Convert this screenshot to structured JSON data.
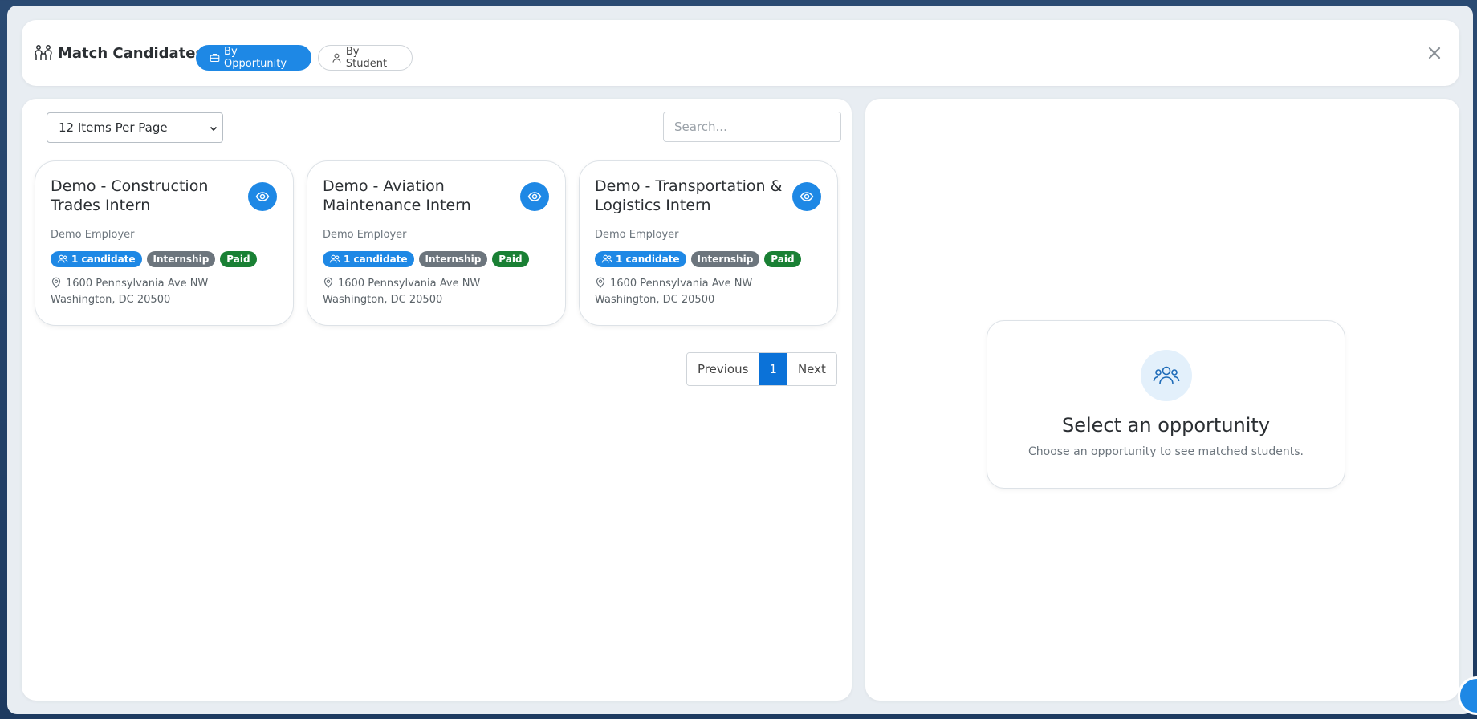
{
  "header": {
    "title": "Match Candidates",
    "tabs": [
      {
        "label": "By Opportunity",
        "active": true
      },
      {
        "label": "By Student",
        "active": false
      }
    ]
  },
  "controls": {
    "per_page": "12 Items Per Page",
    "search_placeholder": "Search..."
  },
  "cards": [
    {
      "title": "Demo - Construction Trades Intern",
      "employer": "Demo Employer",
      "candidates": "1 candidate",
      "type": "Internship",
      "pay": "Paid",
      "address_line1": "1600 Pennsylvania Ave NW",
      "address_line2": "Washington, DC 20500"
    },
    {
      "title": "Demo - Aviation Maintenance Intern",
      "employer": "Demo Employer",
      "candidates": "1 candidate",
      "type": "Internship",
      "pay": "Paid",
      "address_line1": "1600 Pennsylvania Ave NW",
      "address_line2": "Washington, DC 20500"
    },
    {
      "title": "Demo - Transportation & Logistics Intern",
      "employer": "Demo Employer",
      "candidates": "1 candidate",
      "type": "Internship",
      "pay": "Paid",
      "address_line1": "1600 Pennsylvania Ave NW",
      "address_line2": "Washington, DC 20500"
    }
  ],
  "pagination": {
    "previous": "Previous",
    "current": "1",
    "next": "Next"
  },
  "empty_state": {
    "title": "Select an opportunity",
    "subtitle": "Choose an opportunity to see matched students."
  },
  "colors": {
    "accent": "#1e88e5",
    "internship_badge": "#6c757d",
    "paid_badge": "#198034"
  }
}
